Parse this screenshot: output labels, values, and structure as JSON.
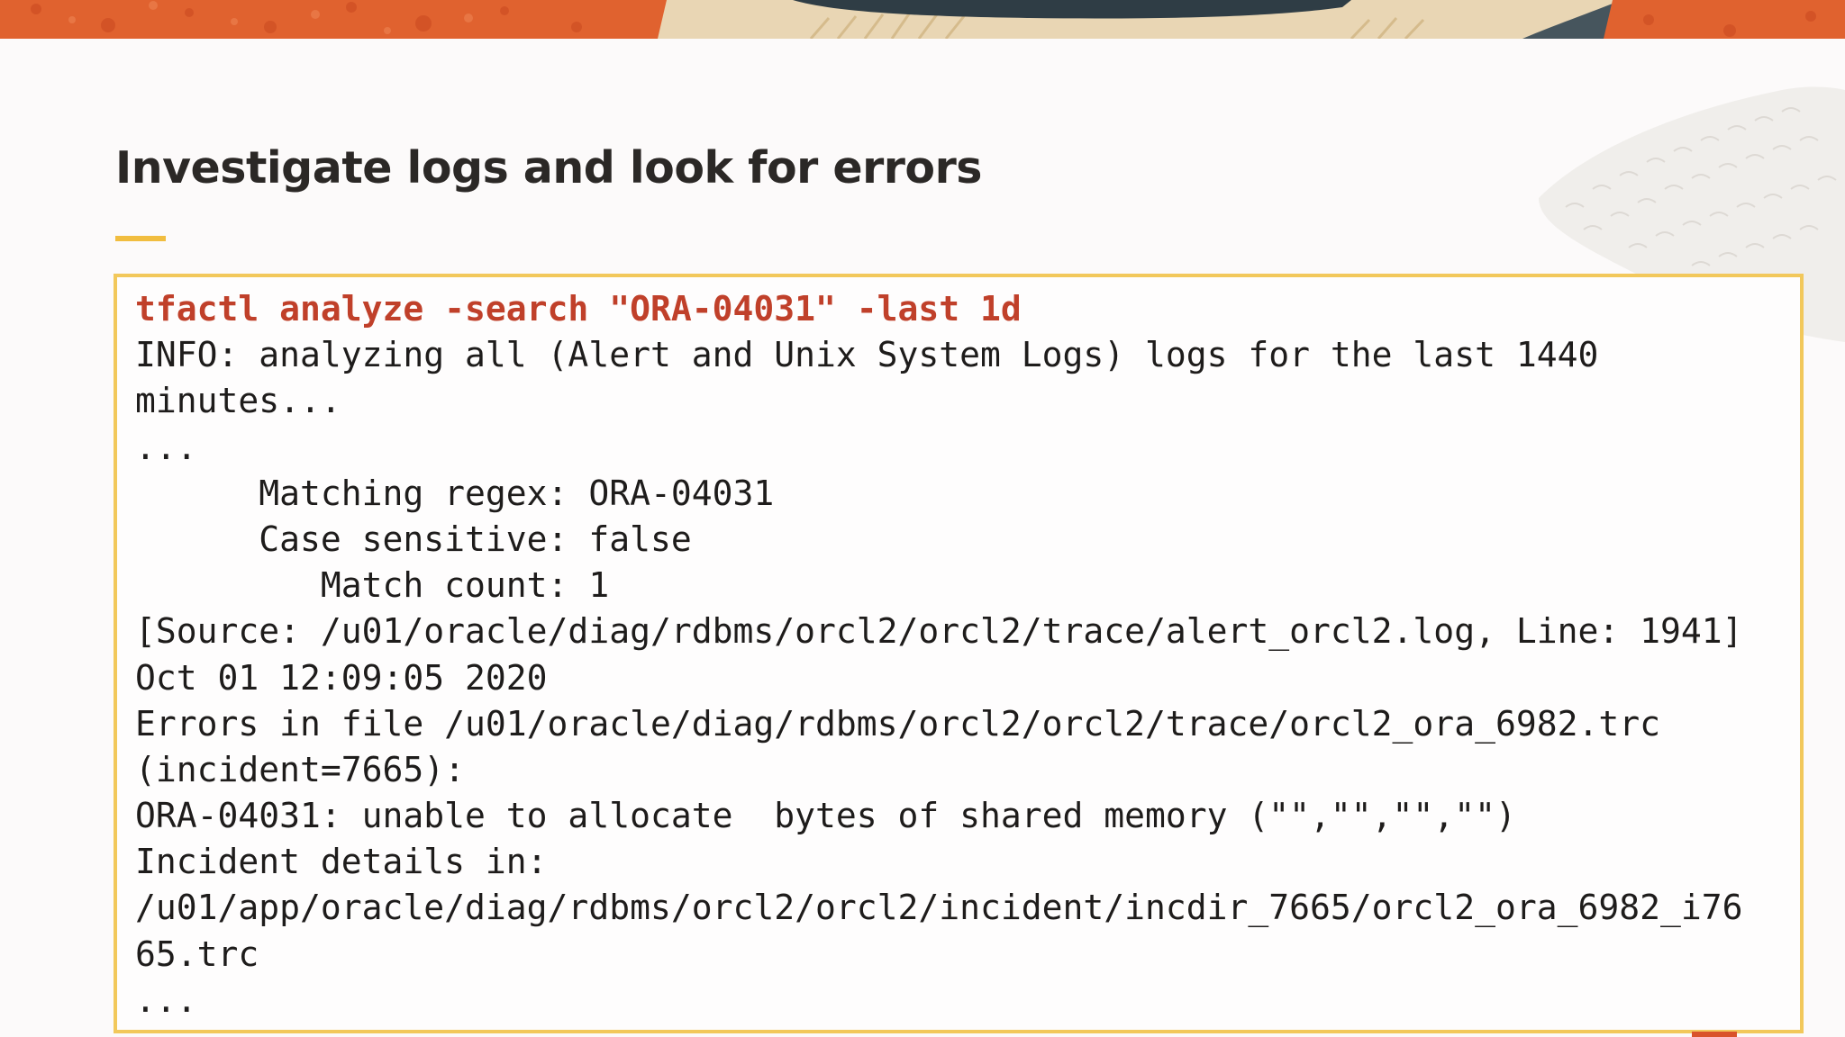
{
  "slide": {
    "title": "Investigate logs and look for errors"
  },
  "colors": {
    "accent_yellow": "#f1bd3f",
    "command_red": "#c0402a",
    "banner_orange": "#e0622f",
    "banner_dark": "#2f3d45",
    "banner_sand": "#e9d6b4"
  },
  "decorations": {
    "banner": "orange-textured-banner-with-dark-wave",
    "right_pattern": "leaf-texture-pattern"
  },
  "terminal": {
    "command": "tfactl analyze -search \"ORA-04031\" -last 1d",
    "output_lines": [
      "INFO: analyzing all (Alert and Unix System Logs) logs for the last 1440",
      "minutes...",
      "...",
      "      Matching regex: ORA-04031",
      "      Case sensitive: false",
      "         Match count: 1",
      "[Source: /u01/oracle/diag/rdbms/orcl2/orcl2/trace/alert_orcl2.log, Line: 1941]",
      "Oct 01 12:09:05 2020",
      "Errors in file /u01/oracle/diag/rdbms/orcl2/orcl2/trace/orcl2_ora_6982.trc",
      "(incident=7665):",
      "ORA-04031: unable to allocate  bytes of shared memory (\"\",\"\",\"\",\"\")",
      "Incident details in:",
      "/u01/app/oracle/diag/rdbms/orcl2/orcl2/incident/incdir_7665/orcl2_ora_6982_i76",
      "65.trc",
      "..."
    ]
  }
}
